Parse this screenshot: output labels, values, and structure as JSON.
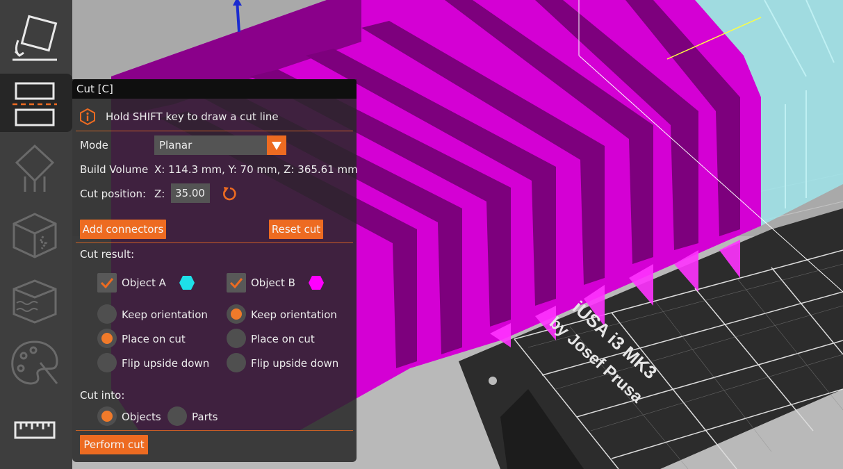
{
  "scene": {
    "bed_logo_line1": "iUSA i3  MK3",
    "bed_logo_line2": "by Josef Prusa",
    "colors": {
      "object_a": "#1ee0e8",
      "object_b": "#ff00ff",
      "accent": "#ed6b21"
    }
  },
  "toolbar": {
    "items": [
      {
        "name": "place-on-face-icon"
      },
      {
        "name": "cut-icon",
        "active": true
      },
      {
        "name": "support-painting-icon"
      },
      {
        "name": "seam-painting-icon"
      },
      {
        "name": "fuzzy-skin-icon"
      },
      {
        "name": "mmu-painting-icon"
      },
      {
        "name": "measure-icon"
      }
    ]
  },
  "cut_panel": {
    "title": "Cut [C]",
    "hint": "Hold SHIFT key to draw a cut line",
    "mode_label": "Mode",
    "mode_value": "Planar",
    "build_volume_label": "Build Volume",
    "build_volume_value": "X: 114.3 mm,  Y: 70 mm,  Z: 365.61 mm",
    "cut_position_label": "Cut position:",
    "axis_label": "Z:",
    "cut_position_value": "35.00",
    "add_connectors_label": "Add connectors",
    "reset_cut_label": "Reset cut",
    "cut_result_label": "Cut result:",
    "object_a": {
      "label": "Object A",
      "checked": true,
      "keep_orientation": "Keep orientation",
      "place_on_cut": "Place on cut",
      "flip_upside_down": "Flip upside down",
      "selected": "place_on_cut"
    },
    "object_b": {
      "label": "Object B",
      "checked": true,
      "keep_orientation": "Keep orientation",
      "place_on_cut": "Place on cut",
      "flip_upside_down": "Flip upside down",
      "selected": "keep_orientation"
    },
    "cut_into_label": "Cut into:",
    "cut_into_objects": "Objects",
    "cut_into_parts": "Parts",
    "cut_into_selected": "objects",
    "perform_cut_label": "Perform cut"
  }
}
